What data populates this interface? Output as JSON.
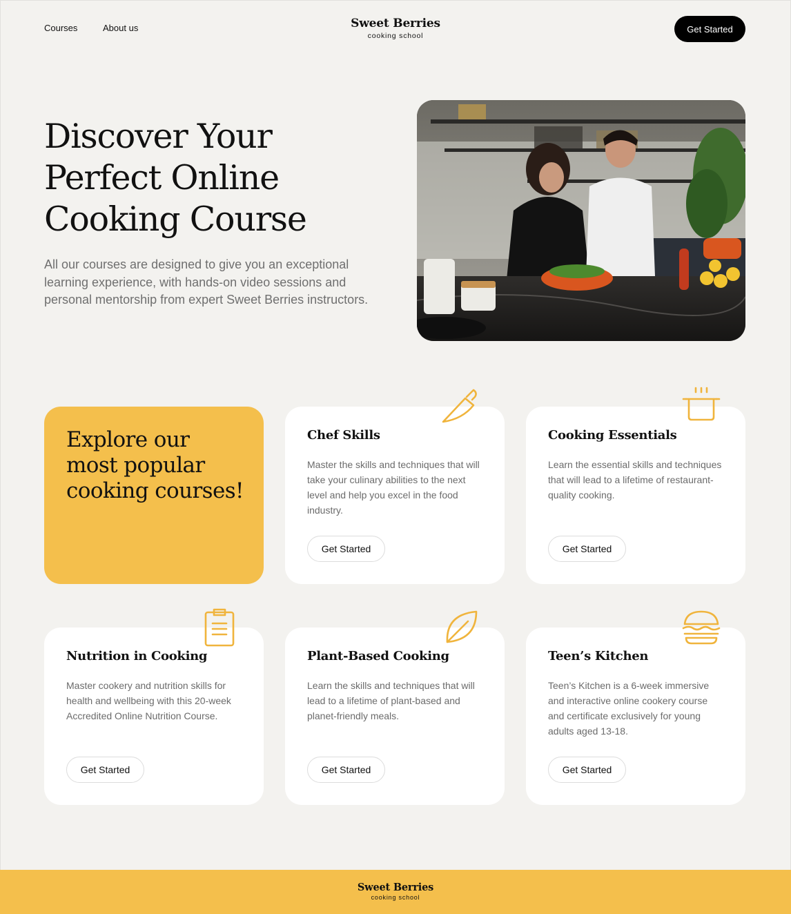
{
  "nav": {
    "courses": "Courses",
    "about": "About us",
    "cta": "Get Started"
  },
  "brand": {
    "name": "Sweet Berries",
    "tagline": "cooking school"
  },
  "hero": {
    "title": "Discover Your Perfect Online Cooking Course",
    "description": "All our courses are designed to give you an exceptional learning experience, with hands-on video sessions and personal mentorship from expert Sweet Berries instructors.",
    "image": "people-cooking-in-kitchen-photo"
  },
  "promo": {
    "text": "Explore our most popular cooking courses!"
  },
  "courses": [
    {
      "title": "Chef Skills",
      "description": "Master the skills and techniques that will take your culinary abilities to the next level and help you excel in the food industry.",
      "button": "Get Started",
      "icon": "knife-icon"
    },
    {
      "title": "Cooking Essentials",
      "description": "Learn the essential skills and techniques that will lead to a lifetime of restaurant-quality cooking.",
      "button": "Get Started",
      "icon": "pot-icon"
    },
    {
      "title": "Nutrition in Cooking",
      "description": "Master cookery and nutrition skills for health and wellbeing with this 20-week Accredited Online Nutrition Course.",
      "button": "Get Started",
      "icon": "clipboard-icon"
    },
    {
      "title": "Plant-Based Cooking",
      "description": "Learn the skills and techniques that will lead to a lifetime of plant-based and planet-friendly meals.",
      "button": "Get Started",
      "icon": "leaf-icon"
    },
    {
      "title": "Teen’s Kitchen",
      "description": "Teen’s Kitchen is a 6-week immersive and interactive online cookery course and certificate exclusively for young adults aged 13-18.",
      "button": "Get Started",
      "icon": "burger-icon"
    }
  ],
  "colors": {
    "background": "#f3f2ef",
    "accent": "#f4bf4c",
    "icon": "#f0b43c",
    "dark": "#000000"
  }
}
